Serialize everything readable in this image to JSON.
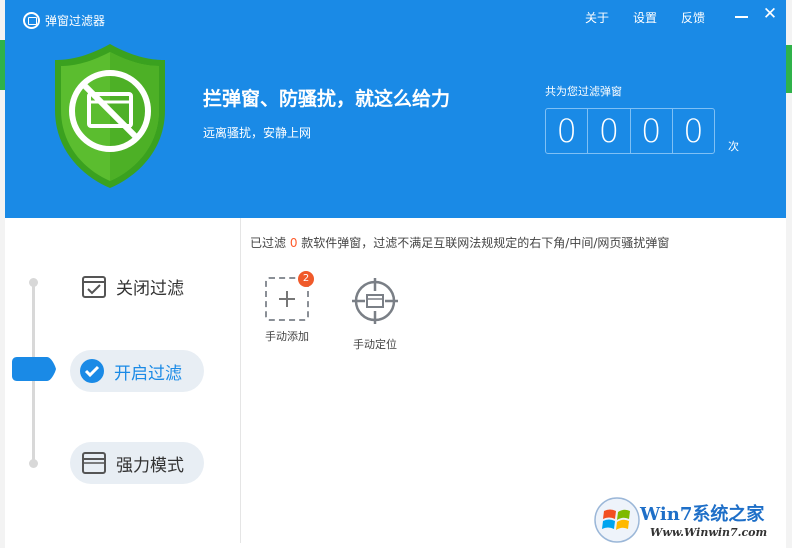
{
  "window": {
    "title": "弹窗过滤器",
    "links": [
      "关于",
      "设置",
      "反馈"
    ]
  },
  "hero": {
    "headline": "拦弹窗、防骚扰，就这么给力",
    "subline": "远离骚扰，安静上网",
    "shield_icon": "shield-no-popup-icon",
    "shield_color": "#5bbd2f"
  },
  "counter": {
    "label": "共为您过滤弹窗",
    "digits": [
      "0",
      "0",
      "0",
      "0"
    ],
    "unit": "次"
  },
  "modes": [
    {
      "label": "关闭过滤",
      "icon": "checkbox-window-icon",
      "active": false
    },
    {
      "label": "开启过滤",
      "icon": "check-circle-icon",
      "active": true
    },
    {
      "label": "强力模式",
      "icon": "window-icon",
      "active": false
    }
  ],
  "info": {
    "prefix": "已过滤 ",
    "count": "0",
    "suffix": " 款软件弹窗，过滤不满足互联网法规规定的右下角/中间/网页骚扰弹窗"
  },
  "tools": [
    {
      "label": "手动添加",
      "icon": "add-icon",
      "badge": "2"
    },
    {
      "label": "手动定位",
      "icon": "crosshair-icon"
    }
  ],
  "watermark": {
    "title": "Win7系统之家",
    "url": "Www.Winwin7.com"
  },
  "colors": {
    "header": "#1a8ae6",
    "accent": "#1a8ae6",
    "badge": "#f05a2a"
  }
}
